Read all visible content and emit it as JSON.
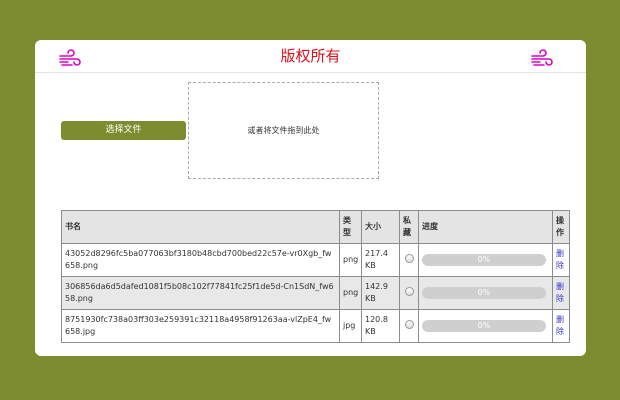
{
  "header": {
    "title": "版权所有"
  },
  "upload": {
    "select_label": "选择文件",
    "drop_text": "或者将文件拖到此处"
  },
  "table": {
    "columns": {
      "name": "书名",
      "type": "类型",
      "size": "大小",
      "private": "私藏",
      "progress": "进度",
      "action": "操作"
    },
    "rows": [
      {
        "name": "43052d8296fc5ba077063bf3180b48cbd700bed22c57e-vr0Xgb_fw658.png",
        "type": "png",
        "size": "217.4 KB",
        "progress": 0,
        "progress_label": "0%",
        "delete_label": "删除"
      },
      {
        "name": "306856da6d5dafed1081f5b08c102f77841fc25f1de5d-Cn1SdN_fw658.png",
        "type": "png",
        "size": "142.9 KB",
        "progress": 0,
        "progress_label": "0%",
        "delete_label": "删除"
      },
      {
        "name": "8751930fc738a03ff303e259391c32118a4958f91263aa-vlZpE4_fw658.jpg",
        "type": "jpg",
        "size": "120.8 KB",
        "progress": 0,
        "progress_label": "0%",
        "delete_label": "删除"
      }
    ]
  },
  "colors": {
    "background": "#7d8c2e",
    "accent": "#7d8c2e",
    "title": "#e0101a",
    "icon": "#e000c8",
    "link": "#3333cc"
  },
  "icons": {
    "header_left": "wind-icon",
    "header_right": "wind-icon"
  }
}
